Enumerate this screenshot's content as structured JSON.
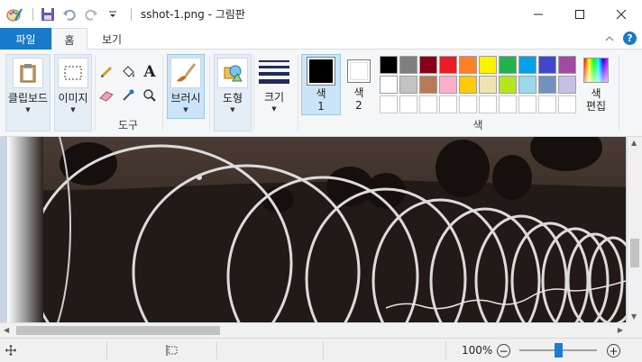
{
  "title_bar": {
    "document_title": "sshot-1.png - 그림판",
    "quick_access": [
      "paint-app-icon",
      "save-icon",
      "undo-icon",
      "redo-icon",
      "customize-dropdown-icon"
    ],
    "window_controls": [
      "minimize-icon",
      "maximize-icon",
      "close-icon"
    ]
  },
  "tabs": {
    "file": "파일",
    "home": "홈",
    "view": "보기"
  },
  "ribbon": {
    "clipboard_label": "클립보드",
    "image_label": "이미지",
    "tools_group_label": "도구",
    "brushes_label": "브러시",
    "shapes_label": "도형",
    "size_label": "크기",
    "color1_label_line1": "색",
    "color1_label_line2": "1",
    "color2_label_line1": "색",
    "color2_label_line2": "2",
    "colors_group_label": "색",
    "edit_colors_line1": "색",
    "edit_colors_line2": "편집",
    "color1_value": "#000000",
    "color2_value": "#ffffff",
    "palette_row1": [
      "#000000",
      "#7f7f7f",
      "#880015",
      "#ed1c24",
      "#ff7f27",
      "#fff200",
      "#22b14c",
      "#00a2e8",
      "#3f48cc",
      "#a349a4"
    ],
    "palette_row2": [
      "#ffffff",
      "#c3c3c3",
      "#b97a57",
      "#ffaec9",
      "#ffc90e",
      "#efe4b0",
      "#b5e61d",
      "#99d9ea",
      "#7092be",
      "#c8bfe7"
    ],
    "palette_row3_empty_count": 10
  },
  "status_bar": {
    "zoom_level": "100%",
    "zoom_fraction": 0.5,
    "move_icon": "move-cursor-icon",
    "selection_icon": "selection-size-icon"
  },
  "scroll": {
    "vertical_position": 0.5,
    "horizontal_position": 0.0
  }
}
